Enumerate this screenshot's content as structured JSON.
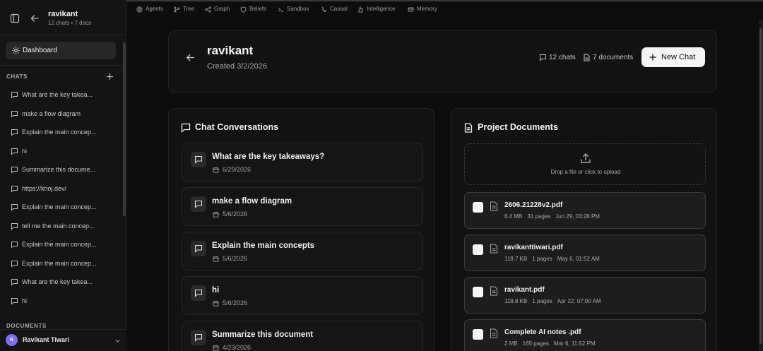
{
  "sidebar": {
    "project_name": "ravikant",
    "project_meta": "12 chats • 7 docs",
    "dashboard_label": "Dashboard",
    "chats_label": "CHATS",
    "documents_label": "DOCUMENTS",
    "chats": [
      {
        "label": "What are the key takea..."
      },
      {
        "label": "make a flow diagram"
      },
      {
        "label": "Explain the main concep..."
      },
      {
        "label": "hi"
      },
      {
        "label": "Summarize this docume..."
      },
      {
        "label": "https://khoj.dev/"
      },
      {
        "label": "Explain the main concep..."
      },
      {
        "label": "tell me the main concep..."
      },
      {
        "label": "Explain the main concep..."
      },
      {
        "label": "Explain the main concep..."
      },
      {
        "label": "What are the key takea..."
      },
      {
        "label": "hi"
      }
    ],
    "user": {
      "initial": "R",
      "name": "Ravikant Tiwari"
    }
  },
  "topnav": {
    "items": [
      {
        "label": "Agents",
        "icon": "agents-icon"
      },
      {
        "label": "Tree",
        "icon": "tree-icon"
      },
      {
        "label": "Graph",
        "icon": "graph-icon"
      },
      {
        "label": "Beliefs",
        "icon": "beliefs-icon"
      },
      {
        "label": "Sandbox",
        "icon": "terminal-icon"
      },
      {
        "label": "Causal",
        "icon": "causal-icon"
      },
      {
        "label": "Intelligence",
        "icon": "intelligence-icon"
      },
      {
        "label": "Memory",
        "icon": "memory-icon"
      }
    ]
  },
  "header": {
    "title": "ravikant",
    "created": "Created 3/2/2026",
    "chats_count": "12 chats",
    "docs_count": "7 documents",
    "new_chat_label": "New Chat"
  },
  "conversations": {
    "title": "Chat Conversations",
    "items": [
      {
        "title": "What are the key takeaways?",
        "date": "6/29/2026"
      },
      {
        "title": "make a flow diagram",
        "date": "5/6/2026"
      },
      {
        "title": "Explain the main concepts",
        "date": "5/6/2026"
      },
      {
        "title": "hi",
        "date": "5/6/2026"
      },
      {
        "title": "Summarize this document",
        "date": "4/23/2026"
      }
    ]
  },
  "documents": {
    "title": "Project Documents",
    "upload_text": "Drop a file or click to upload",
    "items": [
      {
        "name": "2606.21228v2.pdf",
        "size": "6.4 MB",
        "pages": "31 pages",
        "date": "Jun 29, 03:28 PM"
      },
      {
        "name": "ravikanttiwari.pdf",
        "size": "118.7 KB",
        "pages": "1 pages",
        "date": "May 6, 01:52 AM"
      },
      {
        "name": "ravikant.pdf",
        "size": "118.8 KB",
        "pages": "1 pages",
        "date": "Apr 22, 07:00 AM"
      },
      {
        "name": "Complete AI notes .pdf",
        "size": "2 MB",
        "pages": "165 pages",
        "date": "Mar 6, 11:52 PM"
      }
    ]
  },
  "colors": {
    "background": "#0d0d0d",
    "sidebar": "#141414",
    "accent": "#f5f5f5",
    "avatar": "#7b6ef0"
  }
}
